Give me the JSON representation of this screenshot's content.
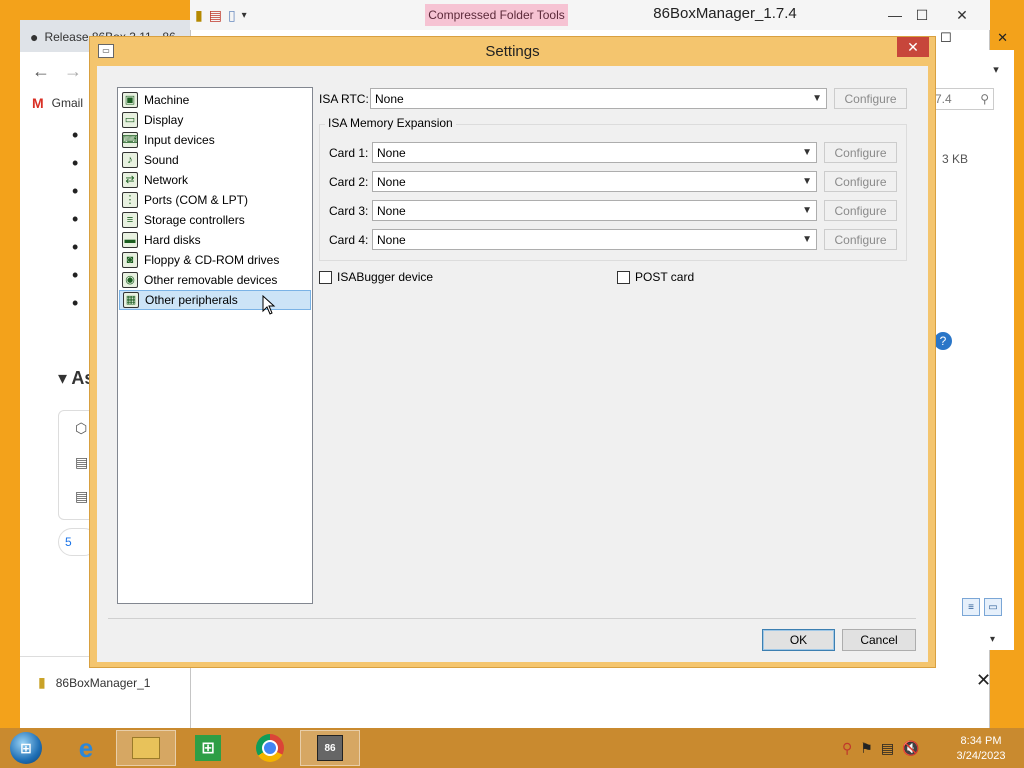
{
  "browser": {
    "tab_title": "Release 86Box 3.11 · 86",
    "bookmark_gmail": "Gmail",
    "section_marker": "▾ As",
    "pill_text": "5",
    "download_filename": "86BoxManager_1"
  },
  "explorer": {
    "context_tab": "Compressed Folder Tools",
    "title": "86BoxManager_1.7.4",
    "search_value": "7.4",
    "size_value": "3 KB"
  },
  "dialog": {
    "title": "Settings",
    "nav_items": [
      {
        "label": "Machine",
        "icon": "machine-icon"
      },
      {
        "label": "Display",
        "icon": "display-icon"
      },
      {
        "label": "Input devices",
        "icon": "input-devices-icon"
      },
      {
        "label": "Sound",
        "icon": "sound-icon"
      },
      {
        "label": "Network",
        "icon": "network-icon"
      },
      {
        "label": "Ports (COM & LPT)",
        "icon": "ports-icon"
      },
      {
        "label": "Storage controllers",
        "icon": "storage-controllers-icon"
      },
      {
        "label": "Hard disks",
        "icon": "hard-disks-icon"
      },
      {
        "label": "Floppy & CD-ROM drives",
        "icon": "floppy-cdrom-icon"
      },
      {
        "label": "Other removable devices",
        "icon": "removable-devices-icon"
      },
      {
        "label": "Other peripherals",
        "icon": "peripherals-icon"
      }
    ],
    "selected_nav": "Other peripherals",
    "isa_rtc": {
      "label": "ISA RTC:",
      "value": "None",
      "configure": "Configure"
    },
    "memory_expansion": {
      "title": "ISA Memory Expansion",
      "cards": [
        {
          "label": "Card 1:",
          "value": "None",
          "configure": "Configure"
        },
        {
          "label": "Card 2:",
          "value": "None",
          "configure": "Configure"
        },
        {
          "label": "Card 3:",
          "value": "None",
          "configure": "Configure"
        },
        {
          "label": "Card 4:",
          "value": "None",
          "configure": "Configure"
        }
      ]
    },
    "isabugger": {
      "label": "ISABugger device",
      "checked": false
    },
    "post_card": {
      "label": "POST card",
      "checked": false
    },
    "ok_label": "OK",
    "cancel_label": "Cancel"
  },
  "taskbar": {
    "apps": [
      "internet-explorer",
      "file-explorer",
      "store",
      "chrome",
      "86box"
    ],
    "time": "8:34 PM",
    "date": "3/24/2023"
  },
  "colors": {
    "desktop": "#f3a21b",
    "dialog_frame": "#f4c56e",
    "taskbar": "#c98a2f",
    "selection": "#cce4f7",
    "close_button": "#c7463b"
  }
}
